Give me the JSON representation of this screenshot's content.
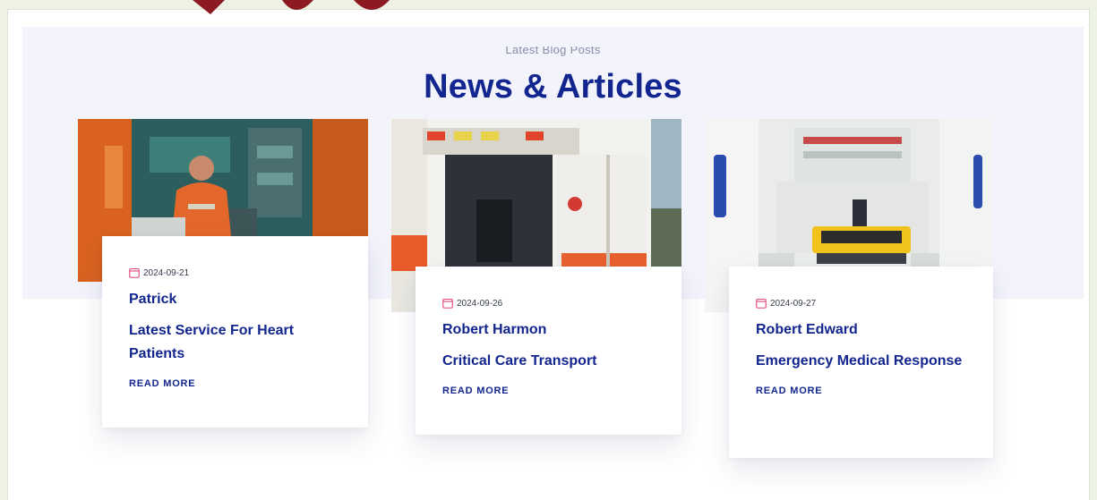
{
  "section": {
    "subtitle": "Latest Blog Posts",
    "title": "News & Articles"
  },
  "posts": [
    {
      "image": "paramedic-in-ambulance-photo",
      "date": "2024-09-21",
      "author": "Patrick",
      "title": "Latest Service For Heart Patients",
      "read_more": "READ MORE"
    },
    {
      "image": "ambulance-rear-open-photo",
      "date": "2024-09-26",
      "author": "Robert Harmon",
      "title": "Critical Care Transport",
      "read_more": "READ MORE"
    },
    {
      "image": "ambulance-interior-stretcher-photo",
      "date": "2024-09-27",
      "author": "Robert Edward",
      "title": "Emergency Medical Response",
      "read_more": "READ MORE"
    }
  ],
  "icons": {
    "date": "calendar-icon"
  },
  "colors": {
    "accent": "#13268f",
    "band": "#f3f3fc",
    "calendar": "#e0457b"
  }
}
